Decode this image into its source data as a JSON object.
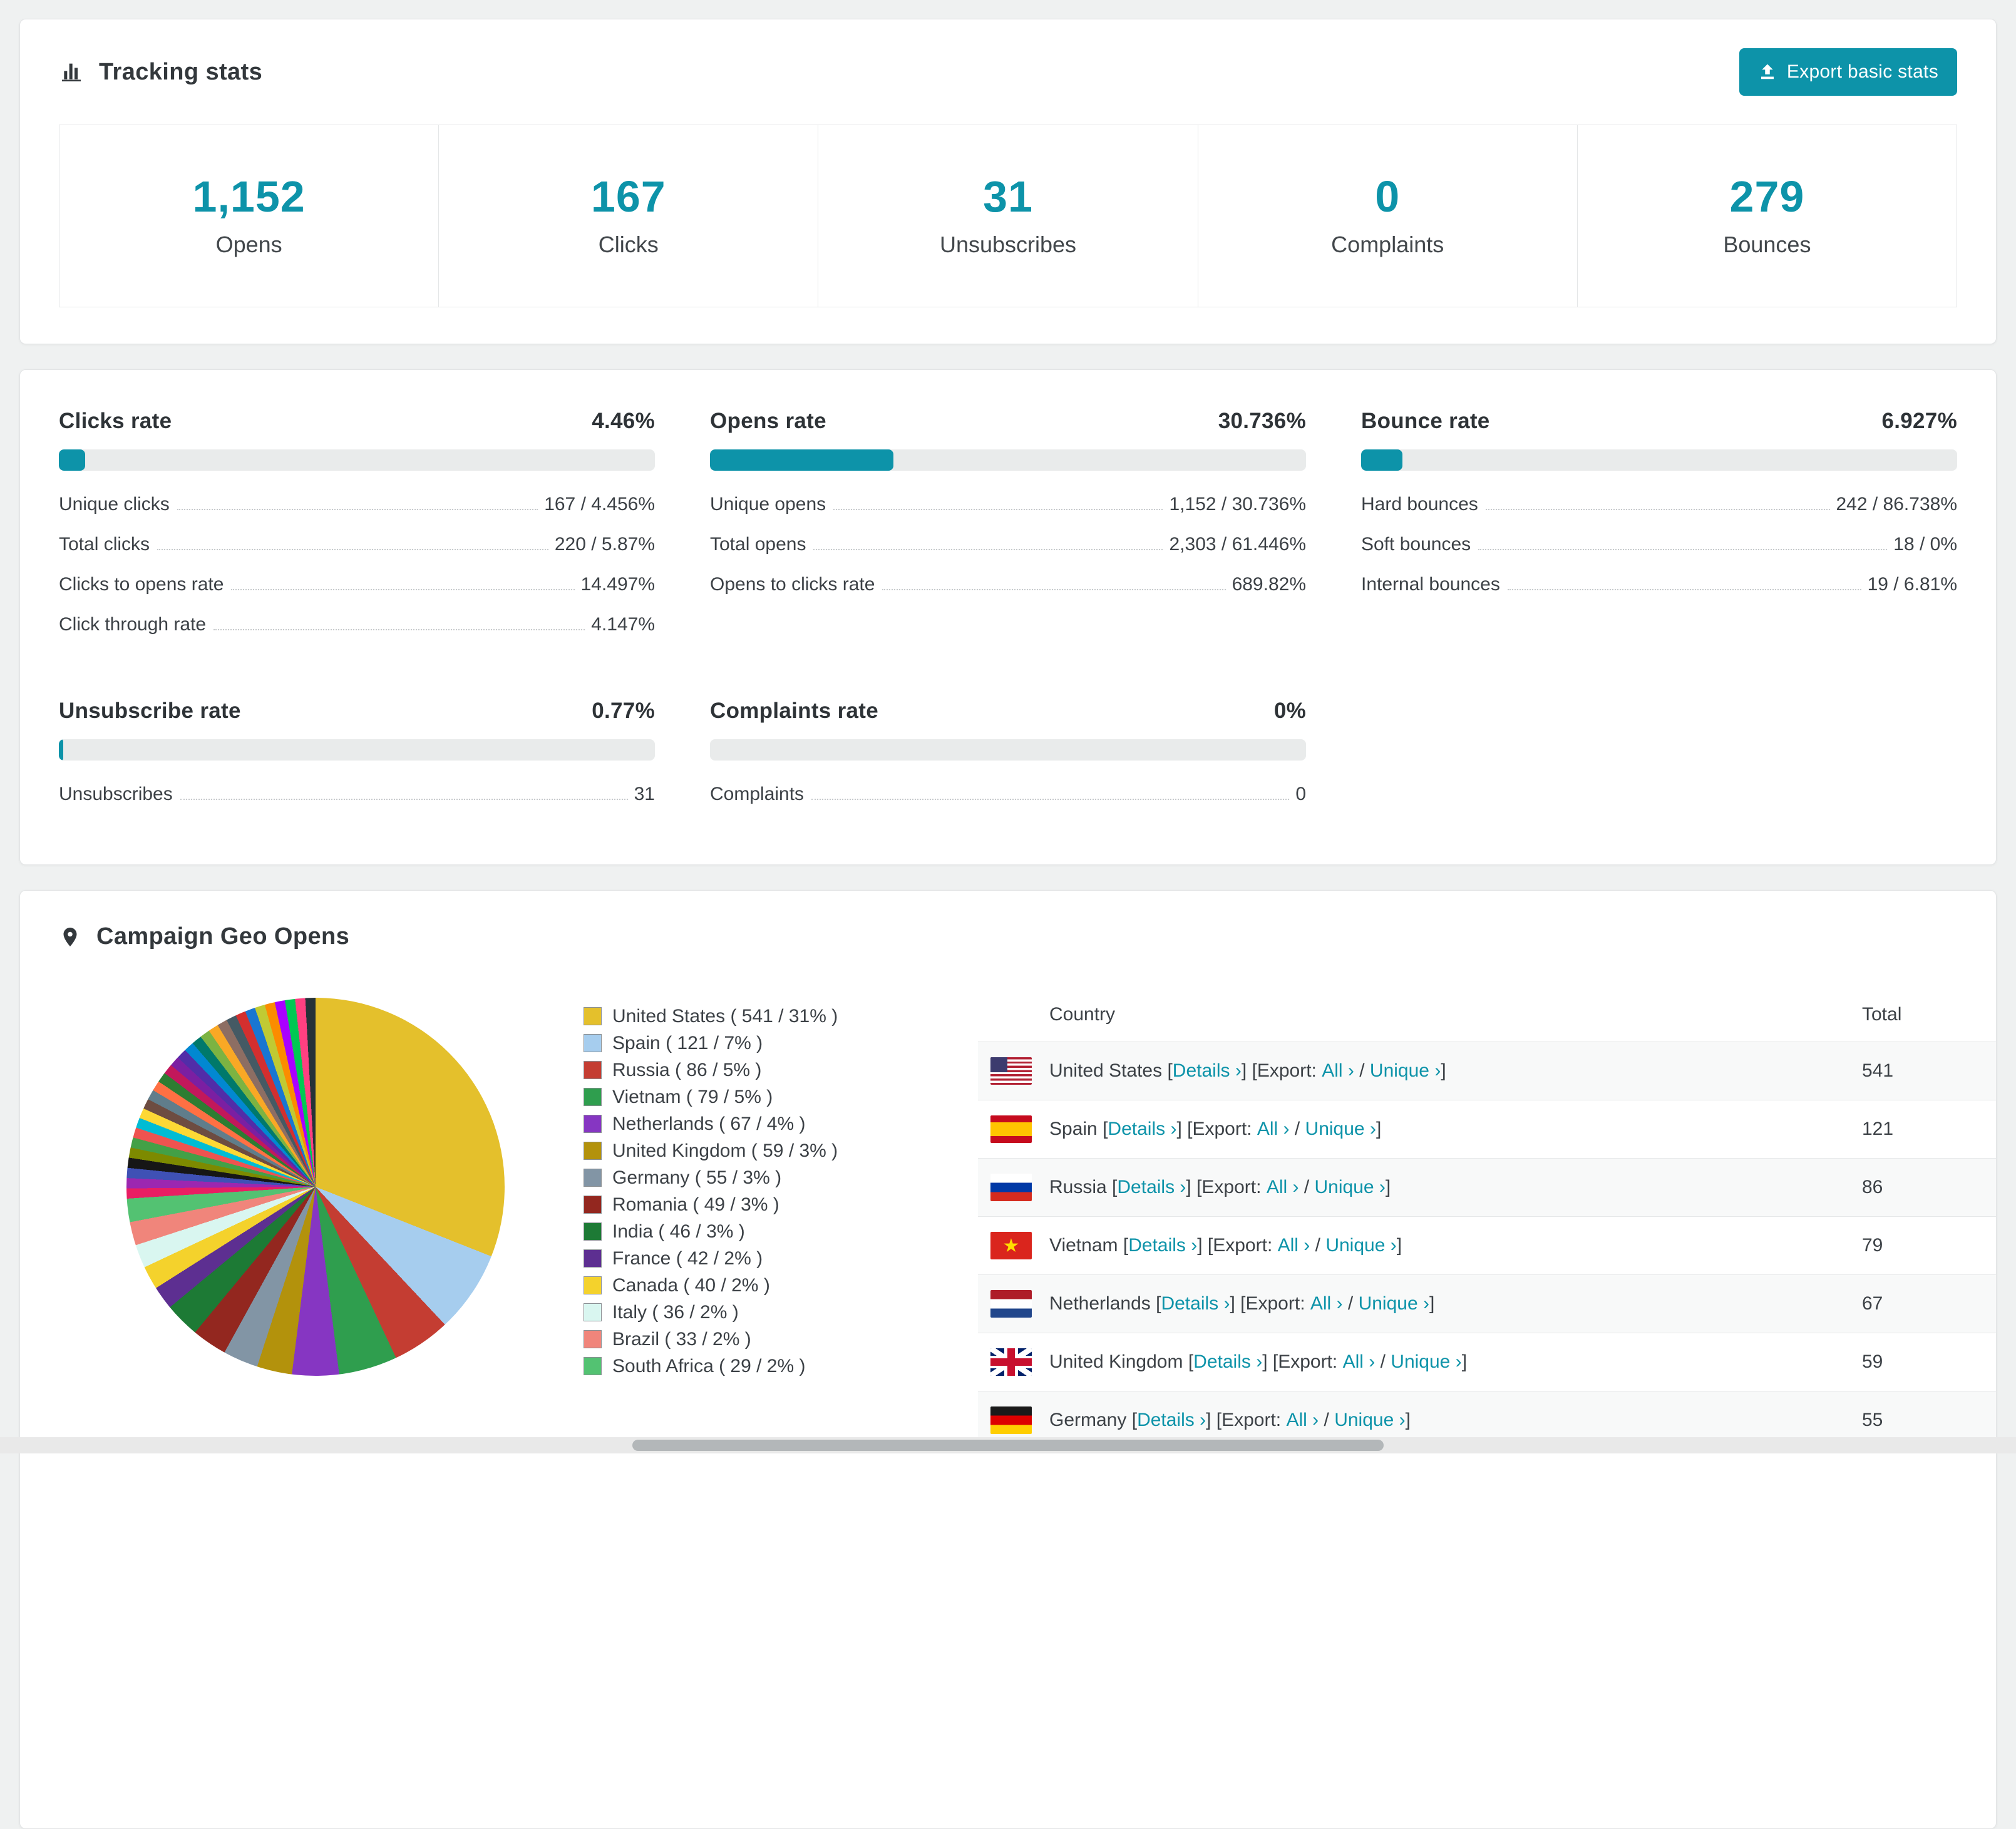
{
  "colors": {
    "accent": "#0d93a9",
    "page_bg": "#eff1f1",
    "text": "#3c4146"
  },
  "tracking": {
    "title": "Tracking stats",
    "export_button": "Export basic stats",
    "stats": [
      {
        "value": "1,152",
        "label": "Opens"
      },
      {
        "value": "167",
        "label": "Clicks"
      },
      {
        "value": "31",
        "label": "Unsubscribes"
      },
      {
        "value": "0",
        "label": "Complaints"
      },
      {
        "value": "279",
        "label": "Bounces"
      }
    ]
  },
  "rates": [
    {
      "title": "Clicks rate",
      "percent_label": "4.46%",
      "fill": 4.46,
      "rows": [
        {
          "label": "Unique clicks",
          "value": "167 / 4.456%"
        },
        {
          "label": "Total clicks",
          "value": "220 / 5.87%"
        },
        {
          "label": "Clicks to opens rate",
          "value": "14.497%"
        },
        {
          "label": "Click through rate",
          "value": "4.147%"
        }
      ]
    },
    {
      "title": "Opens rate",
      "percent_label": "30.736%",
      "fill": 30.736,
      "rows": [
        {
          "label": "Unique opens",
          "value": "1,152 / 30.736%"
        },
        {
          "label": "Total opens",
          "value": "2,303 / 61.446%"
        },
        {
          "label": "Opens to clicks rate",
          "value": "689.82%"
        }
      ]
    },
    {
      "title": "Bounce rate",
      "percent_label": "6.927%",
      "fill": 6.927,
      "rows": [
        {
          "label": "Hard bounces",
          "value": "242 / 86.738%"
        },
        {
          "label": "Soft bounces",
          "value": "18 / 0%"
        },
        {
          "label": "Internal bounces",
          "value": "19 / 6.81%"
        }
      ]
    },
    {
      "title": "Unsubscribe rate",
      "percent_label": "0.77%",
      "fill": 0.77,
      "rows": [
        {
          "label": "Unsubscribes",
          "value": "31"
        }
      ]
    },
    {
      "title": "Complaints rate",
      "percent_label": "0%",
      "fill": 0,
      "rows": [
        {
          "label": "Complaints",
          "value": "0"
        }
      ]
    }
  ],
  "geo": {
    "title": "Campaign Geo Opens",
    "chart_data": {
      "type": "pie",
      "title": "Campaign Geo Opens",
      "slices": [
        {
          "label": "United States",
          "value": 541,
          "percent": 31,
          "color": "#e4c02c",
          "legend": "United States ( 541 / 31% )"
        },
        {
          "label": "Spain",
          "value": 121,
          "percent": 7,
          "color": "#a6cdee",
          "legend": "Spain ( 121 / 7% )"
        },
        {
          "label": "Russia",
          "value": 86,
          "percent": 5,
          "color": "#c43d32",
          "legend": "Russia ( 86 / 5% )"
        },
        {
          "label": "Vietnam",
          "value": 79,
          "percent": 5,
          "color": "#2f9e4e",
          "legend": "Vietnam ( 79 / 5% )"
        },
        {
          "label": "Netherlands",
          "value": 67,
          "percent": 4,
          "color": "#8636c2",
          "legend": "Netherlands ( 67 / 4% )"
        },
        {
          "label": "United Kingdom",
          "value": 59,
          "percent": 3,
          "color": "#b3920c",
          "legend": "United Kingdom ( 59 / 3% )"
        },
        {
          "label": "Germany",
          "value": 55,
          "percent": 3,
          "color": "#8295a5",
          "legend": "Germany ( 55 / 3% )"
        },
        {
          "label": "Romania",
          "value": 49,
          "percent": 3,
          "color": "#93271f",
          "legend": "Romania ( 49 / 3% )"
        },
        {
          "label": "India",
          "value": 46,
          "percent": 3,
          "color": "#1d7a35",
          "legend": "India ( 46 / 3% )"
        },
        {
          "label": "France",
          "value": 42,
          "percent": 2,
          "color": "#5d2f91",
          "legend": "France ( 42 / 2% )"
        },
        {
          "label": "Canada",
          "value": 40,
          "percent": 2,
          "color": "#f4d22c",
          "legend": "Canada ( 40 / 2% )"
        },
        {
          "label": "Italy",
          "value": 36,
          "percent": 2,
          "color": "#d9f6f0",
          "legend": "Italy ( 36 / 2% )"
        },
        {
          "label": "Brazil",
          "value": 33,
          "percent": 2,
          "color": "#f0857b",
          "legend": "Brazil ( 33 / 2% )"
        },
        {
          "label": "South Africa",
          "value": 29,
          "percent": 2,
          "color": "#53c272",
          "legend": "South Africa ( 29 / 2% )"
        }
      ],
      "others_percent": 26,
      "others_colors": [
        "#e91e63",
        "#9c27b0",
        "#3f51b5",
        "#161616",
        "#7d8a00",
        "#43a047",
        "#ef5350",
        "#00bcd4",
        "#fdd835",
        "#6d4c41",
        "#607d8b",
        "#ff7043",
        "#2e7d32",
        "#c2185b",
        "#7b1fa2",
        "#512da8",
        "#0288d1",
        "#00796b",
        "#7cb342",
        "#f9a825",
        "#8d6e63",
        "#455a64",
        "#d32f2f",
        "#1976d2",
        "#c0ca33",
        "#fb8c00",
        "#aa00ff",
        "#00c853",
        "#ff4081",
        "#263238"
      ]
    },
    "table": {
      "country_header": "Country",
      "total_header": "Total",
      "link_strings": {
        "open_bracket": "[",
        "details": "Details ›",
        "close_open_export": "] [Export:",
        "all": "All ›",
        "slash": "/",
        "unique": "Unique ›",
        "close_bracket": "]"
      },
      "rows": [
        {
          "flag": "us",
          "country": "United States",
          "total": "541"
        },
        {
          "flag": "es",
          "country": "Spain",
          "total": "121"
        },
        {
          "flag": "ru",
          "country": "Russia",
          "total": "86"
        },
        {
          "flag": "vn",
          "country": "Vietnam",
          "total": "79"
        },
        {
          "flag": "nl",
          "country": "Netherlands",
          "total": "67"
        },
        {
          "flag": "gb",
          "country": "United Kingdom",
          "total": "59"
        },
        {
          "flag": "de",
          "country": "Germany",
          "total": "55"
        }
      ]
    }
  }
}
